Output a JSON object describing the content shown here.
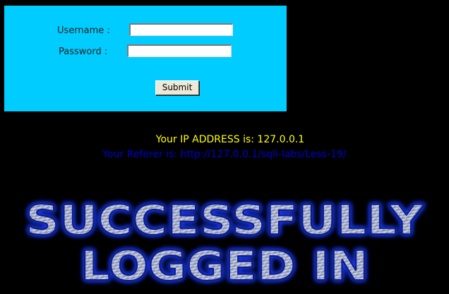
{
  "login_form": {
    "username_label": "Username :",
    "username_value": "",
    "password_label": "Password :",
    "password_value": "",
    "submit_label": "Submit"
  },
  "info": {
    "ip_text": "Your IP ADDRESS is: 127.0.0.1",
    "referer_text": "Your Referer is: http://127.0.0.1/sqli-labs/Less-19/"
  },
  "banner": {
    "line1": "SUCCESSFULLY",
    "line2": "LOGGED IN",
    "fill_color": "#9aa6c8",
    "glow_color": "#1e3cff"
  },
  "colors": {
    "background": "#000000",
    "panel": "#00ccff",
    "ip_text": "#ffff00",
    "referer_text": "#0000cc"
  }
}
